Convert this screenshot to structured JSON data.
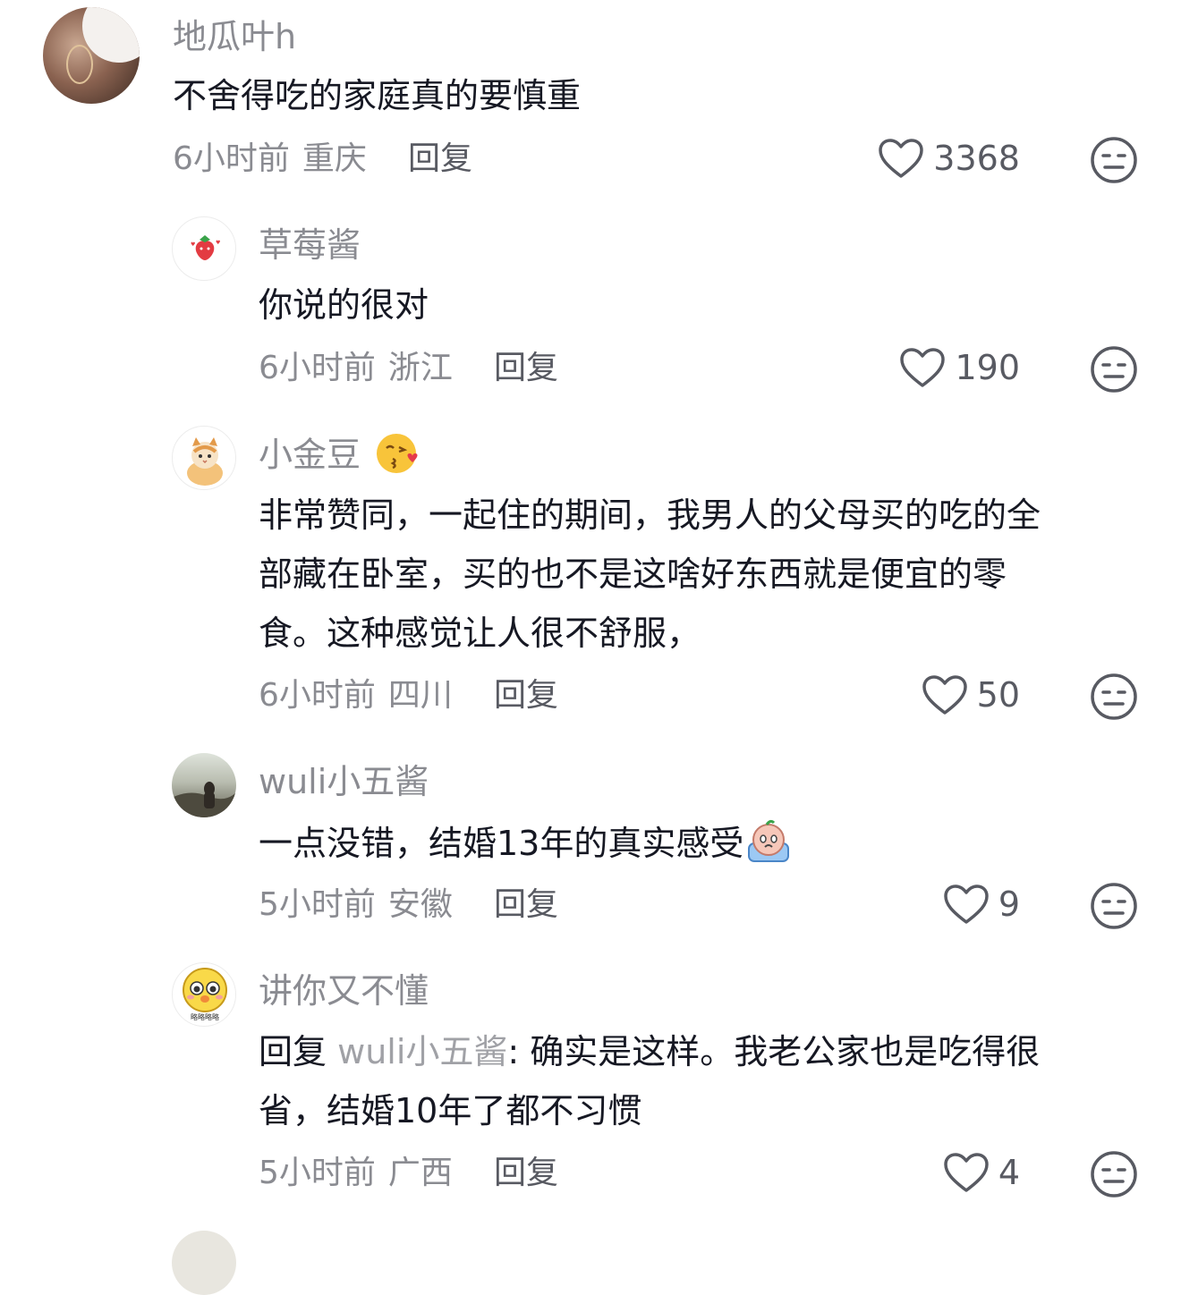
{
  "comments": [
    {
      "user": "地瓜叶h",
      "text": "不舍得吃的家庭真的要慎重",
      "time": "6小时前",
      "location": "重庆",
      "reply_label": "回复",
      "likes": "3368"
    },
    {
      "user": "草莓酱",
      "text": "你说的很对",
      "time": "6小时前",
      "location": "浙江",
      "reply_label": "回复",
      "likes": "190"
    },
    {
      "user": "小金豆",
      "lines": [
        "非常赞同，一起住的期间，我男人的父母买的吃的全",
        "部藏在卧室，买的也不是这啥好东西就是便宜的零",
        "食。这种感觉让人很不舒服，"
      ],
      "time": "6小时前",
      "location": "四川",
      "reply_label": "回复",
      "likes": "50"
    },
    {
      "user": "wuli小五酱",
      "text": "一点没错，结婚13年的真实感受",
      "time": "5小时前",
      "location": "安徽",
      "reply_label": "回复",
      "likes": "9"
    },
    {
      "user": "讲你又不懂",
      "reply_prefix": "回复",
      "reply_to": "wuli小五酱",
      "line1_rest": ": 确实是这样。我老公家也是吃得很",
      "line2": "省，结婚10年了都不习惯",
      "time": "5小时前",
      "location": "广西",
      "reply_label": "回复",
      "likes": "4",
      "avatar_caption": "略略略略"
    }
  ],
  "icons": {
    "like": "heart-outline-icon",
    "dislike": "meh-face-icon"
  },
  "colors": {
    "secondary_text": "#8a8b91",
    "primary_text": "#161823"
  }
}
